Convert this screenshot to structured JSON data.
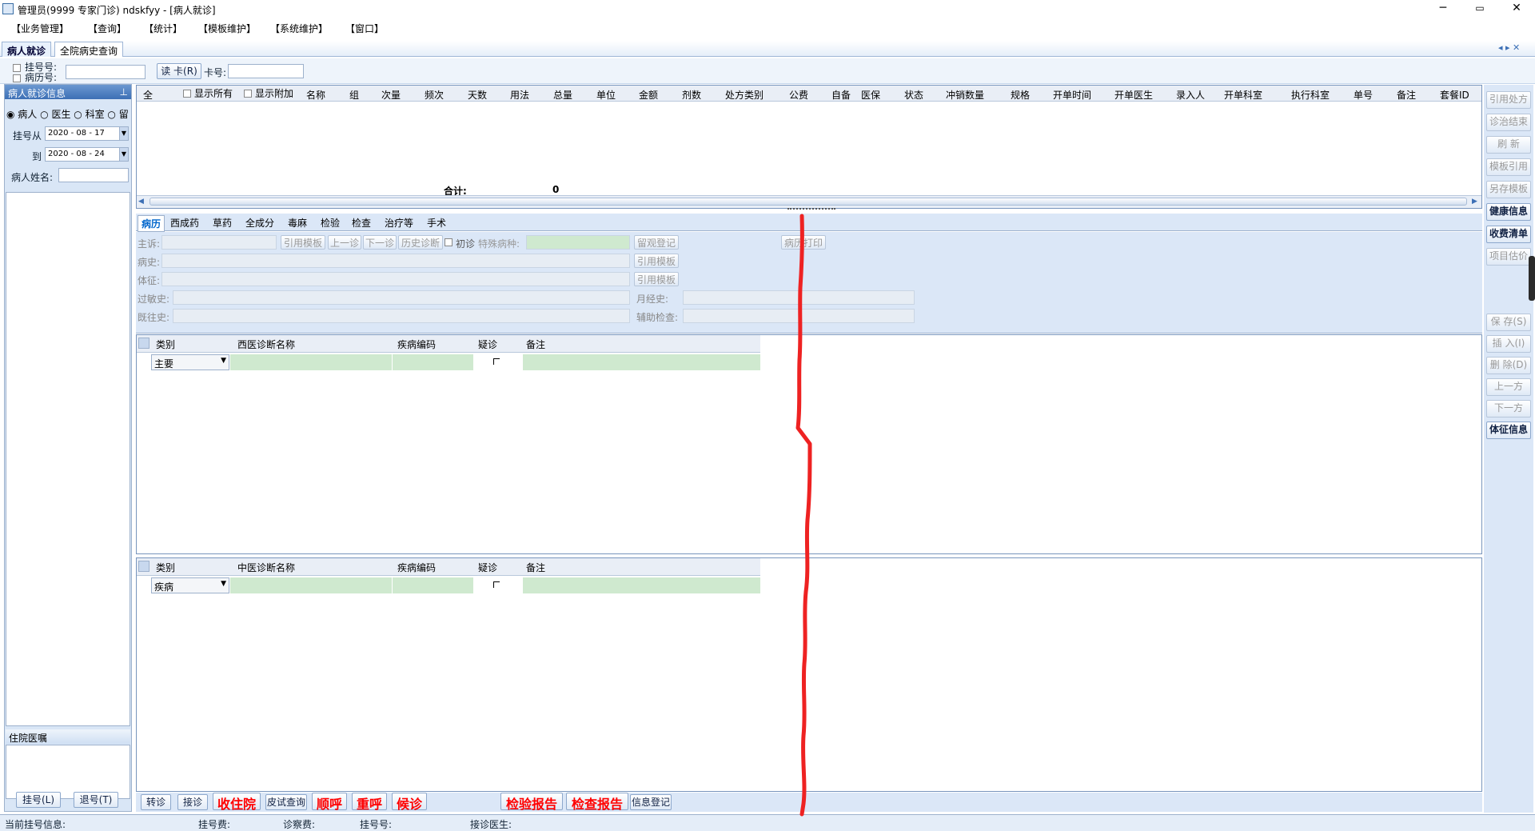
{
  "window": {
    "title": "管理员(9999 专家门诊) ndskfyy - [病人就诊]",
    "minimize": "─",
    "maximize": "▭",
    "close": "✕"
  },
  "menu": [
    "【业务管理】",
    "【查询】",
    "【统计】",
    "【模板维护】",
    "【系统维护】",
    "【窗口】"
  ],
  "tabs": [
    "病人就诊",
    "全院病史查询"
  ],
  "topbar": {
    "reg_no_label": "挂号号:",
    "record_no_label": "病历号:",
    "read_card_label": "读 卡(R)",
    "card_no_label": "卡号:"
  },
  "left": {
    "header": "病人就诊信息",
    "pin": "⊥",
    "radio_patient": "病人",
    "radio_doctor": "医生",
    "radio_dept": "科室",
    "radio_stay": "留",
    "from_label": "挂号从",
    "from_date": "2020 - 08 - 17",
    "to_label": "到",
    "to_date": "2020 - 08 - 24",
    "name_label": "病人姓名:",
    "inpatient_label": "住院医嘱",
    "reg_btn": "挂号(L)",
    "unreg_btn": "退号(T)"
  },
  "rx_grid": {
    "show_all": "显示所有",
    "show_extra": "显示附加",
    "headers": [
      "全",
      "名称",
      "组",
      "次量",
      "频次",
      "天数",
      "用法",
      "总量",
      "单位",
      "金额",
      "剂数",
      "处方类别",
      "公费",
      "自备",
      "医保",
      "状态",
      "冲销数量",
      "规格",
      "开单时间",
      "开单医生",
      "录入人",
      "开单科室",
      "执行科室",
      "单号",
      "备注",
      "套餐ID"
    ],
    "total_label": "合计:",
    "total_value": "0"
  },
  "subtabs": [
    "病历",
    "西成药",
    "草药",
    "全成分",
    "毒麻",
    "检验",
    "检查",
    "治疗等",
    "手术"
  ],
  "record": {
    "chief_label": "主诉:",
    "cite_tpl": "引用模板",
    "prev_visit": "上一诊",
    "next_visit": "下一诊",
    "history_diag": "历史诊断",
    "first_visit": "初诊",
    "special_label": "特殊病种:",
    "observe_reg": "留观登记",
    "print_record": "病历打印",
    "history_label": "病史:",
    "sign_label": "体征:",
    "allergy_label": "过敏史:",
    "menstrual_label": "月经史:",
    "past_label": "既往史:",
    "aux_label": "辅助检查:"
  },
  "west_grid": {
    "headers": [
      "类别",
      "西医诊断名称",
      "疾病编码",
      "疑诊",
      "备注"
    ],
    "row_type": "主要"
  },
  "chinese_grid": {
    "headers": [
      "类别",
      "中医诊断名称",
      "疾病编码",
      "疑诊",
      "备注"
    ],
    "row_type": "疾病"
  },
  "right_buttons": [
    "引用处方",
    "诊治结束",
    "刷 新",
    "模板引用",
    "另存模板",
    "健康信息",
    "收费清单",
    "项目估价",
    "保 存(S)",
    "插 入(I)",
    "删 除(D)",
    "上一方",
    "下一方",
    "体征信息"
  ],
  "bottom_buttons": {
    "transfer": "转诊",
    "accept": "接诊",
    "admit": "收住院",
    "skin_test": "皮试查询",
    "call_next": "顺呼",
    "recall": "重呼",
    "wait": "候诊",
    "lab_report": "检验报告",
    "exam_report": "检查报告",
    "info_reg": "信息登记"
  },
  "status": {
    "current": "当前挂号信息:",
    "reg_fee": "挂号费:",
    "consult_fee": "诊察费:",
    "reg_no": "挂号号:",
    "doctor": "接诊医生:"
  },
  "colors": {
    "annotation_line": "#ee2222",
    "accent": "#3c6fb5"
  }
}
